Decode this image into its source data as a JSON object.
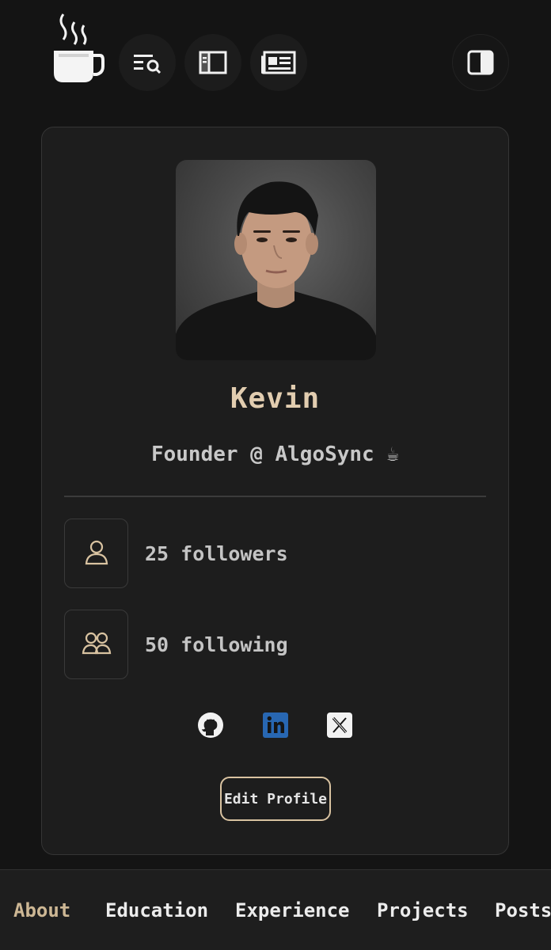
{
  "nav": {
    "logo_icon": "coffee-cup-icon",
    "buttons": [
      {
        "name": "search-list-button",
        "icon": "list-search-icon"
      },
      {
        "name": "sidebar-button",
        "icon": "sidebar-icon"
      },
      {
        "name": "newspaper-button",
        "icon": "newspaper-icon"
      },
      {
        "name": "theme-toggle-button",
        "icon": "contrast-icon"
      }
    ]
  },
  "profile": {
    "name": "Kevin",
    "tagline": "Founder @ AlgoSync ☕",
    "followers": "25 followers",
    "following": "50 following",
    "edit_label": "Edit Profile",
    "socials": [
      "github-icon",
      "linkedin-icon",
      "x-icon"
    ]
  },
  "tabs": [
    {
      "label": "About",
      "active": true
    },
    {
      "label": "Education",
      "active": false
    },
    {
      "label": "Experience",
      "active": false
    },
    {
      "label": "Projects",
      "active": false
    },
    {
      "label": "Posts",
      "active": false
    }
  ],
  "colors": {
    "background": "#141414",
    "card": "#1d1d1d",
    "accent": "#cdb794",
    "name": "#e2cdb0",
    "linkedin": "#2867b2"
  }
}
